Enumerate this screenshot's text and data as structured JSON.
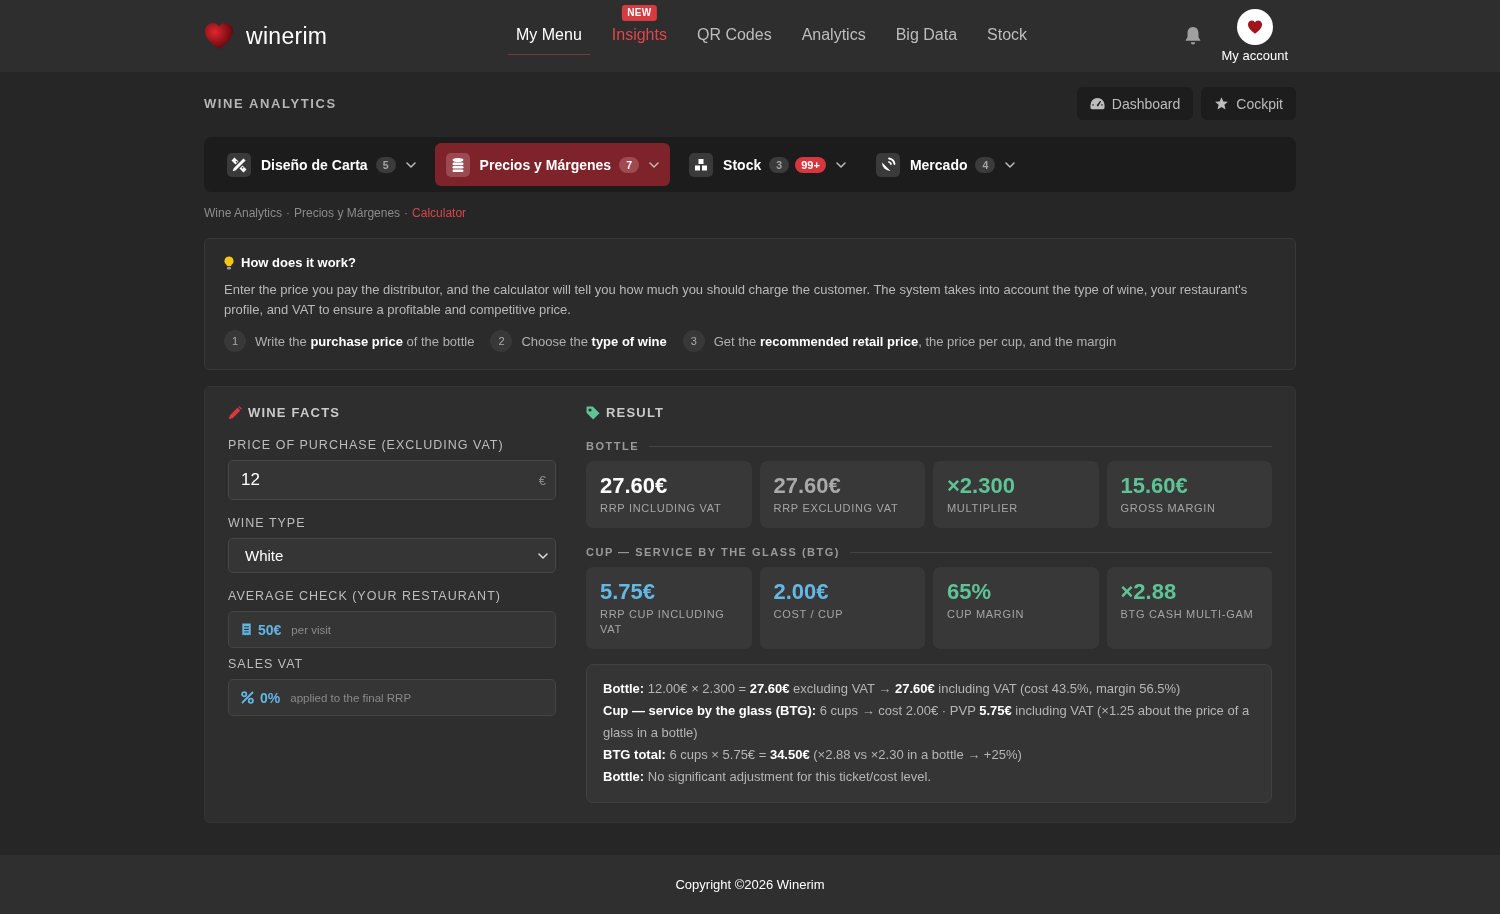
{
  "header": {
    "brand": "winerim",
    "nav": [
      {
        "label": "My Menu",
        "selected": true,
        "highlight": false
      },
      {
        "label": "Insights",
        "selected": false,
        "highlight": true,
        "badge": "NEW"
      },
      {
        "label": "QR Codes",
        "selected": false,
        "highlight": false
      },
      {
        "label": "Analytics",
        "selected": false,
        "highlight": false
      },
      {
        "label": "Big Data",
        "selected": false,
        "highlight": false
      },
      {
        "label": "Stock",
        "selected": false,
        "highlight": false
      }
    ],
    "account": "My account"
  },
  "page_title": "WINE ANALYTICS",
  "actions": [
    "Dashboard",
    "Cockpit"
  ],
  "modules": [
    {
      "label": "Diseño de Carta",
      "count": "5",
      "selected": false
    },
    {
      "label": "Precios y Márgenes",
      "count": "7",
      "selected": true
    },
    {
      "label": "Stock",
      "count": "3",
      "alert": "99+",
      "selected": false
    },
    {
      "label": "Mercado",
      "count": "4",
      "selected": false
    }
  ],
  "breadcrumb": [
    {
      "label": "Wine Analytics",
      "current": false
    },
    {
      "separator": "·",
      "label": "Precios y Márgenes",
      "current": false
    },
    {
      "separator": "·",
      "label": "Calculator",
      "current": true
    }
  ],
  "help": {
    "title": "How does it work?",
    "text": "Enter the price you pay the distributor, and the calculator will tell you how much you should charge the customer. The system takes into account the type of wine, your restaurant's profile, and VAT to ensure a profitable and competitive price.",
    "steps": [
      {
        "number": "1",
        "text": "Write the **purchase price** of the bottle"
      },
      {
        "number": "2",
        "text": "Choose the **type of wine**"
      },
      {
        "number": "3",
        "text": "Get the **recommended retail price**, the price per cup, and the margin"
      }
    ]
  },
  "wine_facts": {
    "title": "WINE FACTS",
    "fields": [
      {
        "kind": "input",
        "label": "PRICE OF PURCHASE (EXCLUDING VAT)",
        "value": "12",
        "suffix": "€"
      },
      {
        "kind": "select",
        "label": "WINE TYPE",
        "value": "White"
      },
      {
        "kind": "readout",
        "label": "AVERAGE CHECK (YOUR RESTAURANT)",
        "value": "50€",
        "note": "per visit"
      },
      {
        "kind": "readout",
        "label": "SALES VAT",
        "value": "0%",
        "note": "applied to the final RRP"
      }
    ]
  },
  "result": {
    "title": "RESULT",
    "sections": [
      {
        "title": "BOTTLE",
        "stats": [
          {
            "value": "27.60€",
            "label": "RRP INCLUDING VAT",
            "color": "#ffffff"
          },
          {
            "value": "27.60€",
            "label": "RRP EXCLUDING VAT",
            "color": "#a9a9a9"
          },
          {
            "value": "×2.300",
            "label": "MULTIPLIER",
            "color": "#5ec396"
          },
          {
            "value": "15.60€",
            "label": "GROSS MARGIN",
            "color": "#5ec396"
          }
        ]
      },
      {
        "title": "CUP — SERVICE BY THE GLASS (BTG)",
        "stats": [
          {
            "value": "5.75€",
            "label": "RRP CUP INCLUDING VAT",
            "color": "#64b8e6"
          },
          {
            "value": "2.00€",
            "label": "COST / CUP",
            "color": "#64b8e6"
          },
          {
            "value": "65%",
            "label": "CUP MARGIN",
            "color": "#5ec396"
          },
          {
            "value": "×2.88",
            "label": "BTG CASH MULTI-GAM",
            "color": "#5ec396"
          }
        ]
      }
    ],
    "summary": [
      "**Bottle:** 12.00€ × 2.300 = **27.60€** excluding VAT → **27.60€** including VAT (cost 43.5%, margin 56.5%)",
      "**Cup — service by the glass (BTG):** 6 cups → cost 2.00€ · PVP **5.75€** including VAT (×1.25 about the price of a glass in a bottle)",
      "**BTG total:** 6 cups × 5.75€ = **34.50€** (×2.88 vs ×2.30 in a bottle → +25%)",
      "**Bottle:** No significant adjustment for this ticket/cost level."
    ]
  },
  "footer": "Copyright ©2026 Winerim"
}
